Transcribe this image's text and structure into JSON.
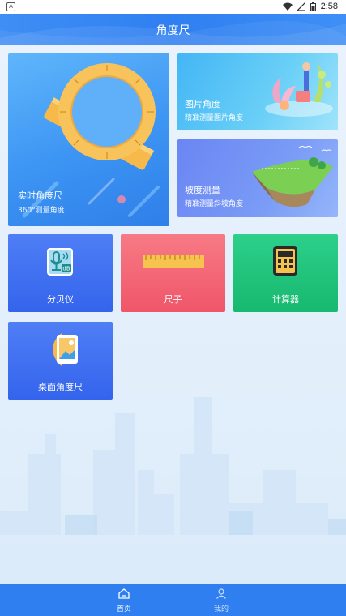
{
  "status_bar": {
    "time": "2:58",
    "left_icon": "A",
    "icons": [
      "wifi-icon",
      "signal-icon",
      "battery-icon"
    ]
  },
  "header": {
    "title": "角度尺"
  },
  "cards": {
    "realtime": {
      "title": "实时角度尺",
      "subtitle": "360°测量角度"
    },
    "photo": {
      "title": "图片角度",
      "subtitle": "精准测量图片角度"
    },
    "slope": {
      "title": "坡度测量",
      "subtitle": "精准测量斜坡角度"
    },
    "decibel": {
      "title": "分贝仪",
      "icon_text": "dB"
    },
    "ruler": {
      "title": "尺子"
    },
    "calculator": {
      "title": "计算器"
    },
    "desktop": {
      "title": "桌面角度尺"
    }
  },
  "bottom_nav": {
    "items": [
      {
        "label": "首页",
        "icon": "home-icon",
        "active": true
      },
      {
        "label": "我的",
        "icon": "user-icon",
        "active": false
      }
    ]
  },
  "colors": {
    "primary": "#2f7ff1",
    "card_blue": "#3c94f3",
    "card_red": "#ef5669",
    "card_green": "#17b86f"
  }
}
